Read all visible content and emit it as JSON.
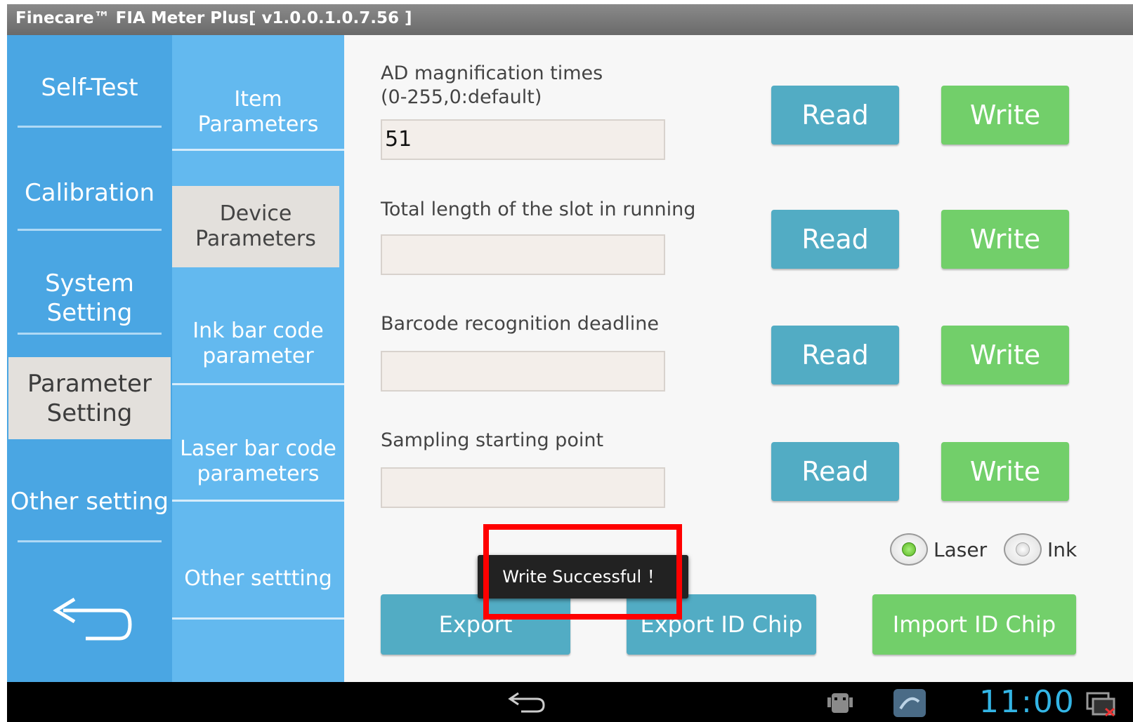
{
  "window": {
    "title": "Finecare™ FIA Meter Plus[ v1.0.0.1.0.7.56 ]"
  },
  "nav_primary": {
    "items": [
      {
        "label_lines": [
          "Self-Test"
        ],
        "active": false
      },
      {
        "label_lines": [
          "Calibration"
        ],
        "active": false
      },
      {
        "label_lines": [
          "System",
          "Setting"
        ],
        "active": false
      },
      {
        "label_lines": [
          "Parameter",
          "Setting"
        ],
        "active": true
      },
      {
        "label_lines": [
          "Other setting"
        ],
        "active": false
      }
    ],
    "back_icon": "back-arrow-icon"
  },
  "nav_secondary": {
    "items": [
      {
        "label_lines": [
          "Item",
          "Parameters"
        ],
        "active": false
      },
      {
        "label_lines": [
          "Device",
          "Parameters"
        ],
        "active": true
      },
      {
        "label_lines": [
          "Ink bar code",
          "parameter"
        ],
        "active": false
      },
      {
        "label_lines": [
          "Laser bar code",
          "parameters"
        ],
        "active": false
      },
      {
        "label_lines": [
          "Other settting"
        ],
        "active": false
      }
    ]
  },
  "fields": [
    {
      "label_lines": [
        "AD magnification times",
        "(0-255,0:default)"
      ],
      "value": "51",
      "read_label": "Read",
      "write_label": "Write"
    },
    {
      "label_lines": [
        "Total length of the slot in running"
      ],
      "value": "",
      "read_label": "Read",
      "write_label": "Write"
    },
    {
      "label_lines": [
        "Barcode recognition deadline"
      ],
      "value": "",
      "read_label": "Read",
      "write_label": "Write"
    },
    {
      "label_lines": [
        "Sampling starting point"
      ],
      "value": "",
      "read_label": "Read",
      "write_label": "Write"
    }
  ],
  "radio_options": [
    {
      "label": "Laser",
      "selected": true
    },
    {
      "label": "Ink",
      "selected": false
    }
  ],
  "bottom_buttons": {
    "export": "Export",
    "export_id_chip": "Export ID Chip",
    "import_id_chip": "Import ID Chip"
  },
  "toast": {
    "message": "Write Successful ！"
  },
  "system_bar": {
    "clock": "11:00",
    "icons": [
      "back-nav-icon",
      "android-debug-icon",
      "app-notification-icon",
      "screen-status-icon"
    ]
  },
  "colors": {
    "nav_primary_bg": "#4aa6e3",
    "nav_secondary_bg": "#63b9ef",
    "read_button": "#52acc4",
    "write_button": "#72cf6a",
    "highlight": "#ff0000",
    "clock": "#33b5e5"
  }
}
